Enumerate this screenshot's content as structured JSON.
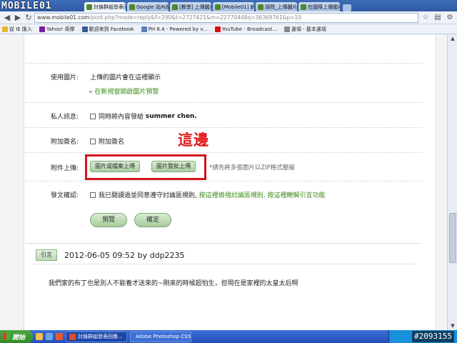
{
  "browser": {
    "logo_text": "MOBILE01",
    "tabs": [
      {
        "label": "討論群組發表回應",
        "active": true
      },
      {
        "label": "Google 站內搜尋",
        "active": false
      },
      {
        "label": "[教學] 上傳圖片",
        "active": false
      },
      {
        "label": "[Mobile01] 網站",
        "active": false
      },
      {
        "label": "請問_上傳圖片",
        "active": false
      },
      {
        "label": "在國際上傳圖片",
        "active": false
      }
    ],
    "url_host": "www.mobile01.com",
    "url_path": "/post.php?mode=reply&f=290&t=2727421&m=22770448q=36369761&p=10",
    "bookmarks": [
      {
        "label": "從 IE 匯入",
        "color": "#e8b62a"
      },
      {
        "label": "Yahoo! 奇摩",
        "color": "#7a1fa2"
      },
      {
        "label": "歡迎來到 Facebook",
        "color": "#3b5998"
      },
      {
        "label": "PH 8.4 - Powered by v...",
        "color": "#5a7fb8"
      },
      {
        "label": "YouTube - Broadcast...",
        "color": "#d11"
      },
      {
        "label": "選項 - 基本選項",
        "color": "#888"
      }
    ]
  },
  "form": {
    "use_image": {
      "label": "使用圖片:",
      "hint": "上傳的圖片會在這裡顯示",
      "preview_link": "» 在新視窗開啟圖片預覽"
    },
    "private_msg": {
      "label": "私人訊息:",
      "text": "同時將內容發給",
      "user": "summer chen."
    },
    "signature": {
      "label": "附加簽名:",
      "text": "附加簽名"
    },
    "attach": {
      "label": "附件上傳:",
      "btn_single": "圖片或檔案上傳",
      "btn_batch": "圖片整批上傳",
      "note": "*請先將多張圖片以ZIP格式壓縮"
    },
    "confirm": {
      "label": "發文確認:",
      "text": "我已閱讀過並同意遵守討論區規則,",
      "link1": "按這裡檢視討論區規則,",
      "link2": "按這裡瞭解引言功能"
    },
    "preview_btn": "預覽",
    "submit_btn": "確定"
  },
  "annotation": "這邊",
  "reply": {
    "quote_btn": "引言",
    "meta": "2012-06-05 09:52 by ddp2235",
    "body": "我們家的布丁也是別人不能養才送來的~剛來的時候超怕生，但現在是家裡的太皇太后啊"
  },
  "taskbar": {
    "start": "開始",
    "tasks": [
      {
        "label": "討論群組發表回應...",
        "color": "#d9502a"
      },
      {
        "label": "Adobe Photoshop CS5",
        "color": "#1f3c7a"
      }
    ]
  },
  "watermark": "#2093155"
}
